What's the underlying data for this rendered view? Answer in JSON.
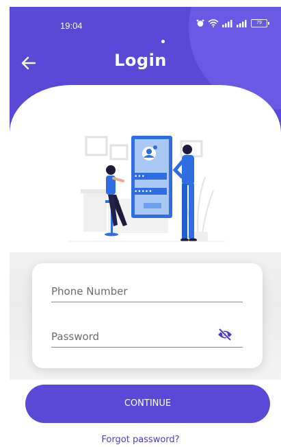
{
  "status_bar": {
    "time": "19:04",
    "battery": "79",
    "icons": [
      "alarm-icon",
      "wifi-icon",
      "signal-icon",
      "signal-icon",
      "battery-icon"
    ]
  },
  "header": {
    "title": "Login",
    "back_icon": "arrow-left-icon"
  },
  "form": {
    "phone": {
      "placeholder": "Phone Number",
      "value": ""
    },
    "password": {
      "placeholder": "Password",
      "value": "",
      "toggle_icon": "eye-slash-icon"
    }
  },
  "actions": {
    "continue_label": "CONTINUE",
    "forgot_label": "Forgot password?"
  },
  "colors": {
    "primary": "#5a48d6",
    "link": "#4b3cc7",
    "figure_blue": "#2f6de0"
  }
}
